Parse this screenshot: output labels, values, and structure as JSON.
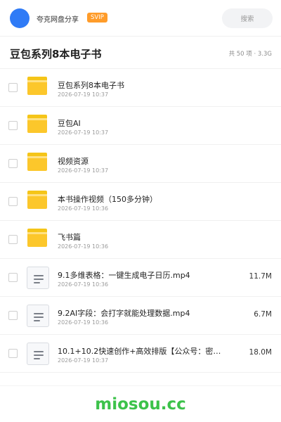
{
  "header": {
    "brand": "夸克网盘分享",
    "badge": "SVIP",
    "search_label": "搜索"
  },
  "folder": {
    "title": "豆包系列8本电子书",
    "summary": "共 50 项 · 3.3G"
  },
  "items": [
    {
      "type": "folder",
      "name": "豆包系列8本电子书",
      "date": "2026-07-19 10:37",
      "size": ""
    },
    {
      "type": "folder",
      "name": "豆包AI",
      "date": "2026-07-19 10:37",
      "size": ""
    },
    {
      "type": "folder",
      "name": "视频资源",
      "date": "2026-07-19 10:37",
      "size": ""
    },
    {
      "type": "folder",
      "name": "本书操作视频（150多分钟）",
      "date": "2026-07-19 10:36",
      "size": ""
    },
    {
      "type": "folder",
      "name": "飞书篇",
      "date": "2026-07-19 10:36",
      "size": ""
    },
    {
      "type": "file",
      "name": "9.1多维表格：一键生成电子日历.mp4",
      "date": "2026-07-19 10:36",
      "size": "11.7M"
    },
    {
      "type": "file",
      "name": "9.2AI字段：会打字就能处理数据.mp4",
      "date": "2026-07-19 10:36",
      "size": "6.7M"
    },
    {
      "type": "file",
      "name": "10.1+10.2快速创作+高效排版【公众号：密知…",
      "date": "2026-07-19 10:37",
      "size": "18.0M"
    }
  ],
  "watermark": "miosou.cc",
  "colors": {
    "accent": "#2f7bf6",
    "badge": "#ff9c2a",
    "folder": "#fcc72b",
    "watermark": "#3cc24a"
  }
}
